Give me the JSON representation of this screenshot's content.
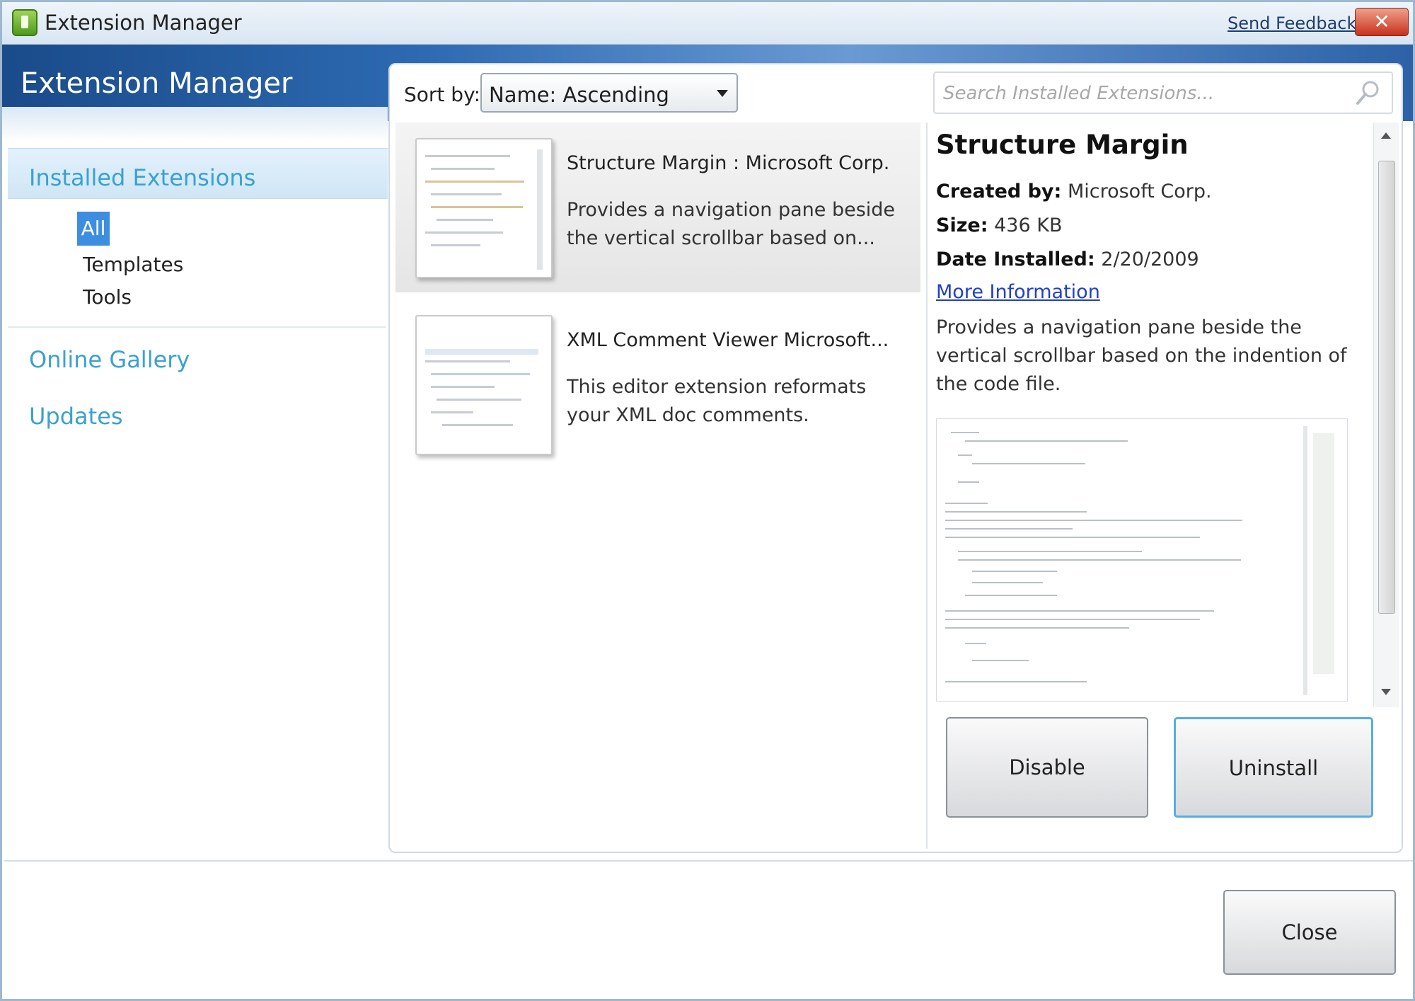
{
  "window": {
    "title": "Extension Manager",
    "send_feedback": "Send Feedback",
    "close_glyph": "✕"
  },
  "header": {
    "title": "Extension Manager"
  },
  "sidebar": {
    "installed_label": "Installed Extensions",
    "sub_items": [
      {
        "label": "All",
        "selected": true
      },
      {
        "label": "Templates"
      },
      {
        "label": "Tools"
      }
    ],
    "online_gallery": "Online Gallery",
    "updates": "Updates"
  },
  "toolbar": {
    "sort_label": "Sort by:",
    "sort_value": "Name: Ascending",
    "search_placeholder": "Search Installed Extensions..."
  },
  "extensions": [
    {
      "title": "Structure Margin : Microsoft Corp.",
      "description": "Provides a navigation pane beside the vertical scrollbar based on...",
      "selected": true
    },
    {
      "title": "XML Comment Viewer  Microsoft...",
      "description": "This editor extension reformats your XML doc comments.",
      "selected": false
    }
  ],
  "detail": {
    "name": "Structure Margin",
    "created_by_label": "Created by:",
    "created_by": "Microsoft Corp.",
    "size_label": "Size:",
    "size": "436 KB",
    "date_label": "Date Installed:",
    "date": "2/20/2009",
    "more_info": "More Information",
    "description": "Provides a navigation pane beside the vertical scrollbar based on the indention of the code file."
  },
  "buttons": {
    "disable": "Disable",
    "uninstall": "Uninstall",
    "close": "Close"
  },
  "colors": {
    "header_blue": "#2d6ab2",
    "nav_link": "#3aa1d0",
    "link_blue": "#2040c8",
    "selected_all": "#3d8ee0"
  }
}
